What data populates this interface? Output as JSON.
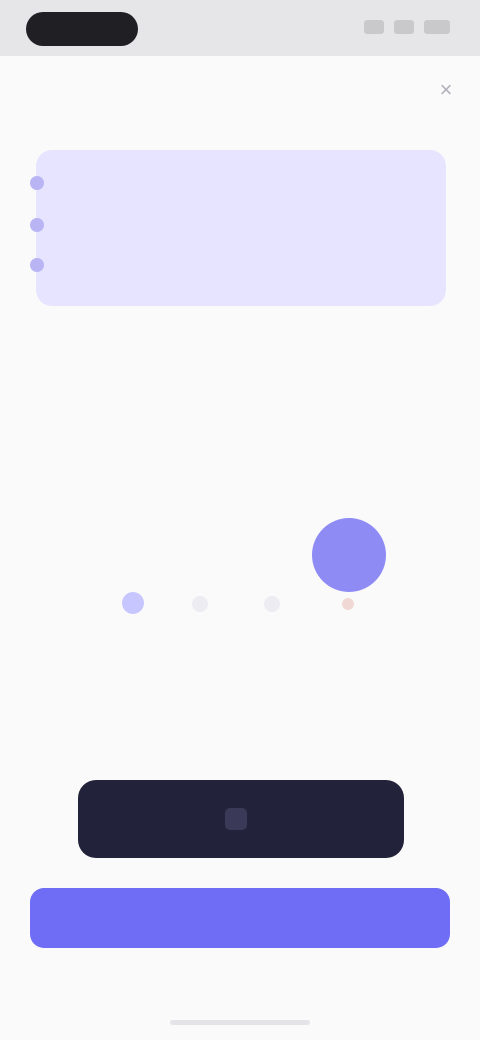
{
  "status_bar": {
    "time": ""
  },
  "header": {
    "title": "",
    "close_icon": "close-icon"
  },
  "info_card": {
    "items": [
      {
        "label": ""
      },
      {
        "label": ""
      },
      {
        "label": ""
      }
    ]
  },
  "description": {
    "title": "",
    "text": ""
  },
  "steps": {
    "count": 4,
    "active_index": 4
  },
  "add_section": {
    "title": "",
    "text": ""
  },
  "buttons": {
    "secondary_label": "",
    "primary_label": ""
  },
  "colors": {
    "accent": "#6f6cf6",
    "card_bg": "#e6e4ff",
    "dark_button": "#22223a",
    "active_step": "#8e8bf5"
  }
}
